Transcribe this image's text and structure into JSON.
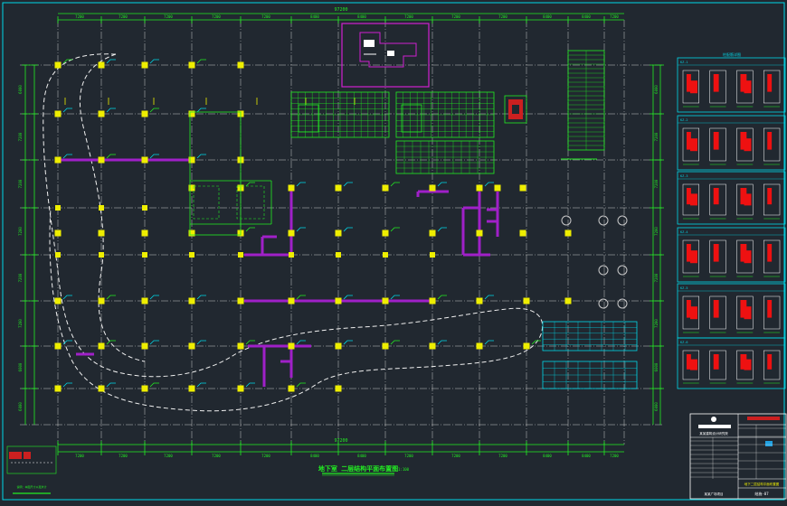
{
  "drawing": {
    "main_title": "地下室 二层结构平面布置图",
    "overall_dim_label": "97200",
    "scale_note": "1:100",
    "sheet_no": "结施-07",
    "sheet_title": "地下二层结构平面布置图",
    "designer_block_title": "某某建筑设计研究院",
    "project_name": "某某广场项目",
    "bottom_note": "说明：本图尺寸以毫米计"
  },
  "axes": {
    "top_spans": [
      "7200",
      "7200",
      "7200",
      "7200",
      "7200",
      "8400",
      "8400",
      "7200",
      "7200",
      "7200",
      "8400",
      "8400",
      "7200",
      "7200"
    ],
    "bottom_spans": [
      "7200",
      "7200",
      "7200",
      "7200",
      "7200",
      "8400",
      "8400",
      "7200",
      "7200",
      "7200",
      "8400",
      "8400",
      "7200",
      "7200"
    ],
    "left_spans": [
      "6000",
      "7200",
      "7200",
      "7200",
      "7200",
      "7200",
      "6000",
      "6000"
    ],
    "right_spans": [
      "6000",
      "7200",
      "7200",
      "7200",
      "7200",
      "7200",
      "6000",
      "6000"
    ]
  },
  "colors": {
    "background": "#212830",
    "frame": "#00d8e8",
    "grid": "#c8c8c8",
    "dimension": "#22ee22",
    "column": "#eeee00",
    "wall": "#a020c8",
    "curve": "#f0f0f0",
    "detail_red": "#ee1111",
    "detail_frame": "#00d8e8"
  },
  "legend": {
    "detail_label": "柱配筋详图",
    "row_labels": [
      "KZ-1",
      "KZ-2",
      "KZ-3",
      "KZ-4",
      "KZ-5",
      "KZ-6"
    ]
  }
}
